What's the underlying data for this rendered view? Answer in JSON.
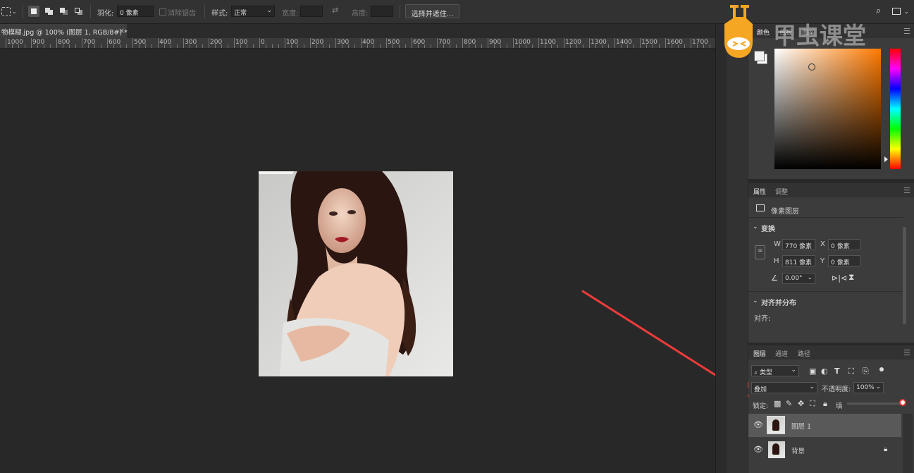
{
  "options_bar": {
    "feather_label": "羽化:",
    "feather_value": "0 像素",
    "antialias_label": "消除锯齿",
    "style_label": "样式:",
    "style_value": "正常",
    "width_label": "宽度:",
    "height_label": "高度:",
    "select_mask_button": "选择并遮住..."
  },
  "document_tab": {
    "title": "物模糊.jpg @ 100% (图层 1, RGB/8#) *",
    "close": "×"
  },
  "ruler": {
    "ticks": [
      "1000",
      "900",
      "800",
      "700",
      "600",
      "500",
      "400",
      "300",
      "200",
      "100",
      "0",
      "100",
      "200",
      "300",
      "400",
      "500",
      "600",
      "700",
      "800",
      "900",
      "1000",
      "1100",
      "1200",
      "1300",
      "1400",
      "1500",
      "1600",
      "1700"
    ]
  },
  "watermark": {
    "text": "甲虫课堂"
  },
  "color_panel": {
    "tabs": [
      "颜色",
      "色板",
      "图案"
    ]
  },
  "properties_panel": {
    "tabs": [
      "属性",
      "调整"
    ],
    "layer_type": "像素图层",
    "transform_section": "变换",
    "w_label": "W",
    "w_value": "770 像素",
    "x_label": "X",
    "x_value": "0 像素",
    "h_label": "H",
    "h_value": "811 像素",
    "y_label": "Y",
    "y_value": "0 像素",
    "angle_value": "0.00°",
    "align_section": "对齐并分布",
    "align_label": "对齐:"
  },
  "layers_panel": {
    "tabs": [
      "图层",
      "通道",
      "路径"
    ],
    "filter_kind": "类型",
    "blend_mode": "叠加",
    "opacity_label": "不透明度:",
    "opacity_value": "100%",
    "lock_label": "锁定:",
    "fill_label": "填",
    "layers": [
      {
        "name": "图层 1",
        "selected": true,
        "locked": false
      },
      {
        "name": "背景",
        "selected": false,
        "locked": true
      }
    ]
  },
  "colors": {
    "annotation_arrow": "#ef3b3b",
    "watermark_orange": "#f5a623"
  }
}
